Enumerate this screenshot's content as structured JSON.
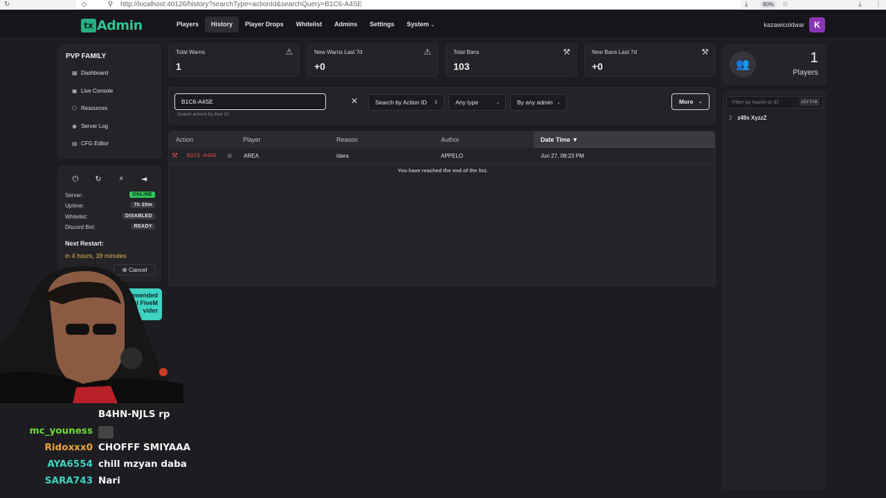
{
  "browser": {
    "url": "http://localhost:40126/history?searchType=actionId&searchQuery=B1C6-A4SE",
    "zoom": "80%"
  },
  "nav": {
    "logo_prefix": "tx",
    "logo_text": "Admin",
    "links": [
      "Players",
      "History",
      "Player Drops",
      "Whitelist",
      "Admins",
      "Settings",
      "System"
    ],
    "active": "History",
    "username": "kazawicoldwar",
    "avatar_letter": "K"
  },
  "sidebar": {
    "server_name": "PVP FAMILY",
    "items": [
      {
        "label": "Dashboard",
        "icon": "grid-icon"
      },
      {
        "label": "Live Console",
        "icon": "terminal-icon"
      },
      {
        "label": "Resources",
        "icon": "box-icon"
      },
      {
        "label": "Server Log",
        "icon": "eye-icon"
      },
      {
        "label": "CFG Editor",
        "icon": "file-icon"
      }
    ],
    "status": {
      "server_label": "Server:",
      "server_value": "ONLINE",
      "uptime_label": "Uptime:",
      "uptime_value": "7h 20m",
      "whitelist_label": "Whitelist:",
      "whitelist_value": "DISABLED",
      "discord_label": "Discord Bot:",
      "discord_value": "READY"
    },
    "next_restart_title": "Next Restart:",
    "next_restart_value": "in 4 hours, 39 minutes",
    "cancel_label": "Cancel"
  },
  "stats": [
    {
      "label": "Total Warns",
      "value": "1",
      "icon": "warning-icon"
    },
    {
      "label": "New Warns Last 7d",
      "value": "+0",
      "icon": "warning-icon"
    },
    {
      "label": "Total Bans",
      "value": "103",
      "icon": "gavel-icon"
    },
    {
      "label": "New Bans Last 7d",
      "value": "+0",
      "icon": "gavel-icon"
    }
  ],
  "search": {
    "value": "B1C6-A4SE",
    "help": "Search actions by their ID.",
    "search_type": "Search by Action ID",
    "type_filter": "Any type",
    "admin_filter": "By any admin",
    "more_label": "More"
  },
  "table": {
    "headers": [
      "Action",
      "Player",
      "Reason",
      "Author",
      "Date Time ▼"
    ],
    "rows": [
      {
        "action": "B1C6-A4SE",
        "player": "AREA",
        "reason": "idara",
        "author": "APPELO",
        "datetime": "Jun 27, 08:23 PM"
      }
    ],
    "end_text": "You have reached the end of the list."
  },
  "players_panel": {
    "count": "1",
    "label": "Players",
    "filter_placeholder": "Filter by Name or ID",
    "shortcut": "ctrl+k",
    "list": [
      {
        "id": "3",
        "name": "z49x XyzzZ"
      }
    ]
  },
  "overlay": {
    "promo_text": "commended\nal FiveM\nvider",
    "chat": [
      {
        "name": "",
        "msg": "B4HN-NJLS rp",
        "color": "#ffffff"
      },
      {
        "name": "mc_youness",
        "msg": "",
        "color": "#6fdc3a"
      },
      {
        "name": "Ridoxxx0",
        "msg": "CHOFFF SMIYAAA",
        "color": "#f0a43a"
      },
      {
        "name": "AYA6554",
        "msg": "chill mzyan daba",
        "color": "#3fd3c2"
      },
      {
        "name": "SARA743",
        "msg": "Nari",
        "color": "#3fd3c2"
      }
    ]
  }
}
